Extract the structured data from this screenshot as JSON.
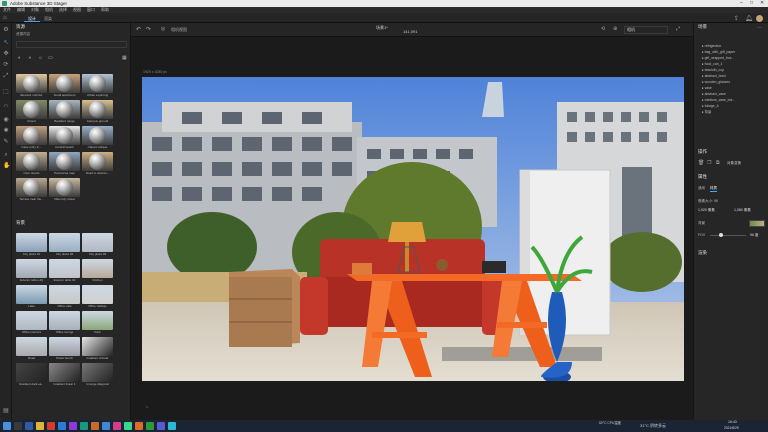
{
  "window": {
    "title": "Adobe Substance 3D Stager"
  },
  "menu": [
    "文件",
    "编辑",
    "对象",
    "相机",
    "选择",
    "视图",
    "窗口",
    "帮助"
  ],
  "tabs": [
    {
      "label": "设计",
      "active": true
    },
    {
      "label": "渲染",
      "active": false
    }
  ],
  "left_panel": {
    "title": "资源",
    "subtab": "资源内容",
    "environments": [
      "Elevator corridor",
      "Small apartment",
      "Urban exploring",
      "Airport",
      "Boulders range",
      "Campus ground",
      "Cave entry in...",
      "Central beach",
      "Classic artique",
      "Over clouds",
      "Panorama map",
      "Road to downto...",
      "Terrace near the...",
      "Villa cozy street"
    ],
    "backplates_title": "背景",
    "backplates": [
      "City plaza 01",
      "City plaza 02",
      "City plaza 03",
      "Exterior table HQ",
      "Exterior table 02",
      "Kitchen",
      "Lake",
      "Office cafe",
      "Office hallway",
      "Office interiors",
      "Office lounge",
      "Park",
      "Road",
      "Street bench",
      "Gradient circular",
      "Gradient dark ea...",
      "Gradient linear 1",
      "Grunge diagonal"
    ]
  },
  "canvas": {
    "resolution": "1920 x 1080 px",
    "camera_label": "相机视图",
    "view_label": "141,091",
    "tab_label": "场景1*",
    "dropdown": "相机"
  },
  "right_panel": {
    "scene_title": "场景",
    "tree": [
      "refrigerator",
      "bag_with_gift_paper",
      "gift_wrapped_box...",
      "food_can_1",
      "teacloth_cup",
      "abstract_bowl",
      "wooden_glasses",
      "vase",
      "abstract_vase",
      "medium_vase_bot...",
      "foliage_A",
      "背景"
    ],
    "actions_title": "操作",
    "actions_btn": "对象变换",
    "properties_title": "属性",
    "prop_tabs": [
      "通用",
      "材质"
    ],
    "size_label": "像素大小: 96",
    "width": "1,920 像素",
    "height": "1,080 像素",
    "bg_label": "背景",
    "slider_value": "96 度",
    "render_title": "渲染"
  },
  "taskbar": {
    "weather": "31°C 阴转多云",
    "cpu": "60°C CPU温度",
    "time": "16:43",
    "date": "2021/8/29"
  },
  "colors": {
    "accent": "#3da5ff",
    "panel": "#262626",
    "bg": "#1b1b1b"
  }
}
